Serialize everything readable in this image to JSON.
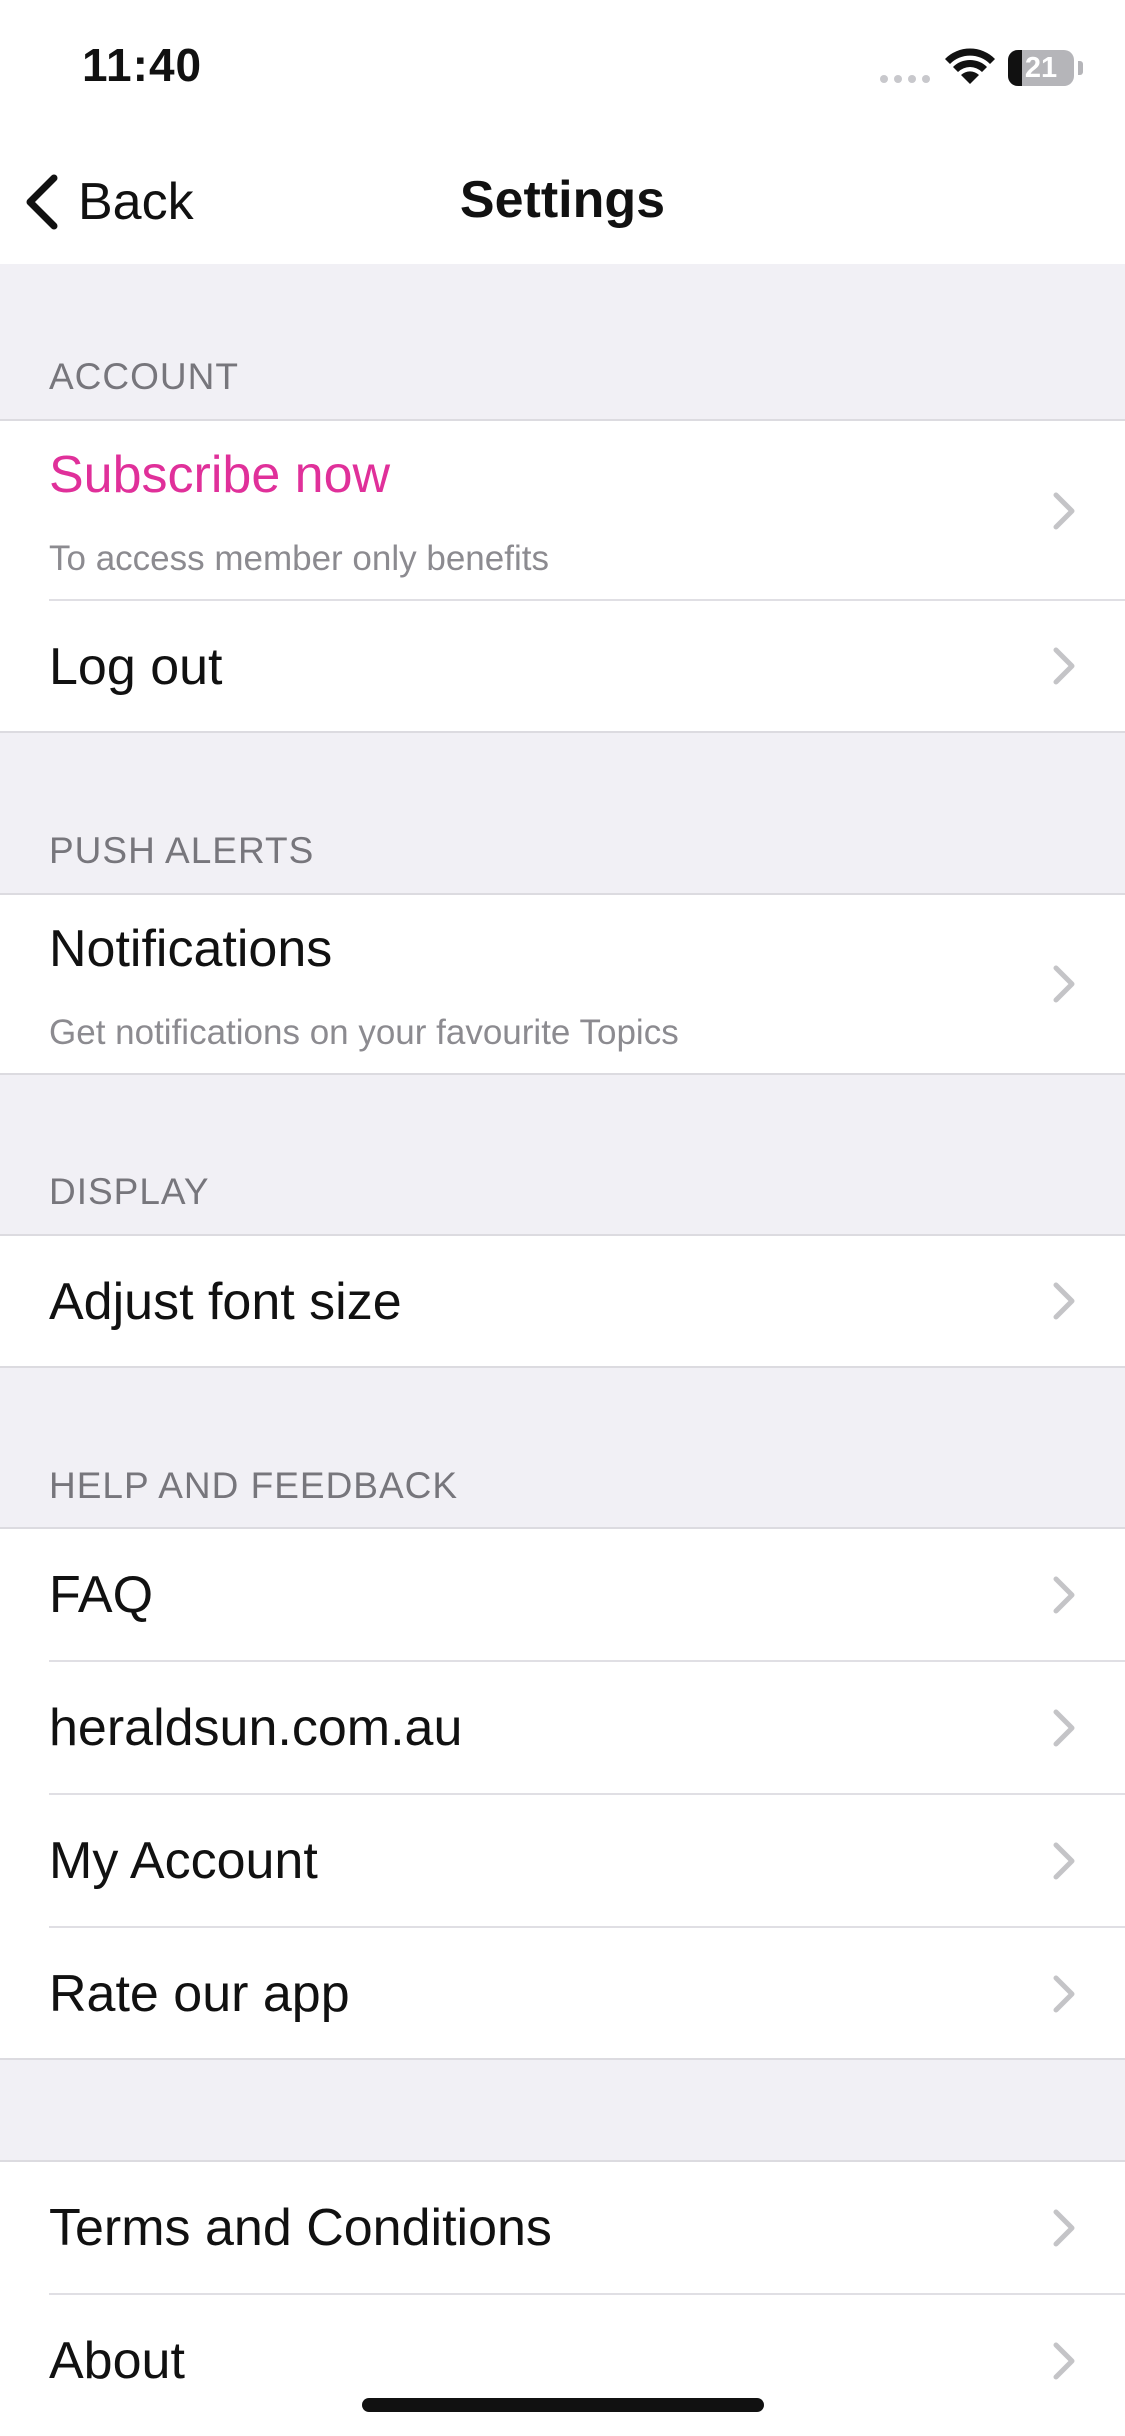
{
  "status_bar": {
    "time": "11:40",
    "battery_level": "21",
    "battery_fraction": 0.21
  },
  "nav": {
    "back_label": "Back",
    "title": "Settings"
  },
  "sections": {
    "account": {
      "header": "ACCOUNT",
      "subscribe_title": "Subscribe now",
      "subscribe_subtitle": "To access member only benefits",
      "logout_title": "Log out"
    },
    "push_alerts": {
      "header": "PUSH ALERTS",
      "notifications_title": "Notifications",
      "notifications_subtitle": "Get notifications on your favourite Topics"
    },
    "display": {
      "header": "DISPLAY",
      "font_size_title": "Adjust font size"
    },
    "help": {
      "header": "HELP AND FEEDBACK",
      "faq_title": "FAQ",
      "website_title": "heraldsun.com.au",
      "my_account_title": "My Account",
      "rate_title": "Rate our app"
    },
    "legal": {
      "terms_title": "Terms and Conditions",
      "about_title": "About"
    }
  },
  "colors": {
    "accent": "#e0309a",
    "background": "#f1f0f5",
    "header_text": "#77767c",
    "subtitle_text": "#8c8b90",
    "chevron": "#c4c4c7"
  }
}
